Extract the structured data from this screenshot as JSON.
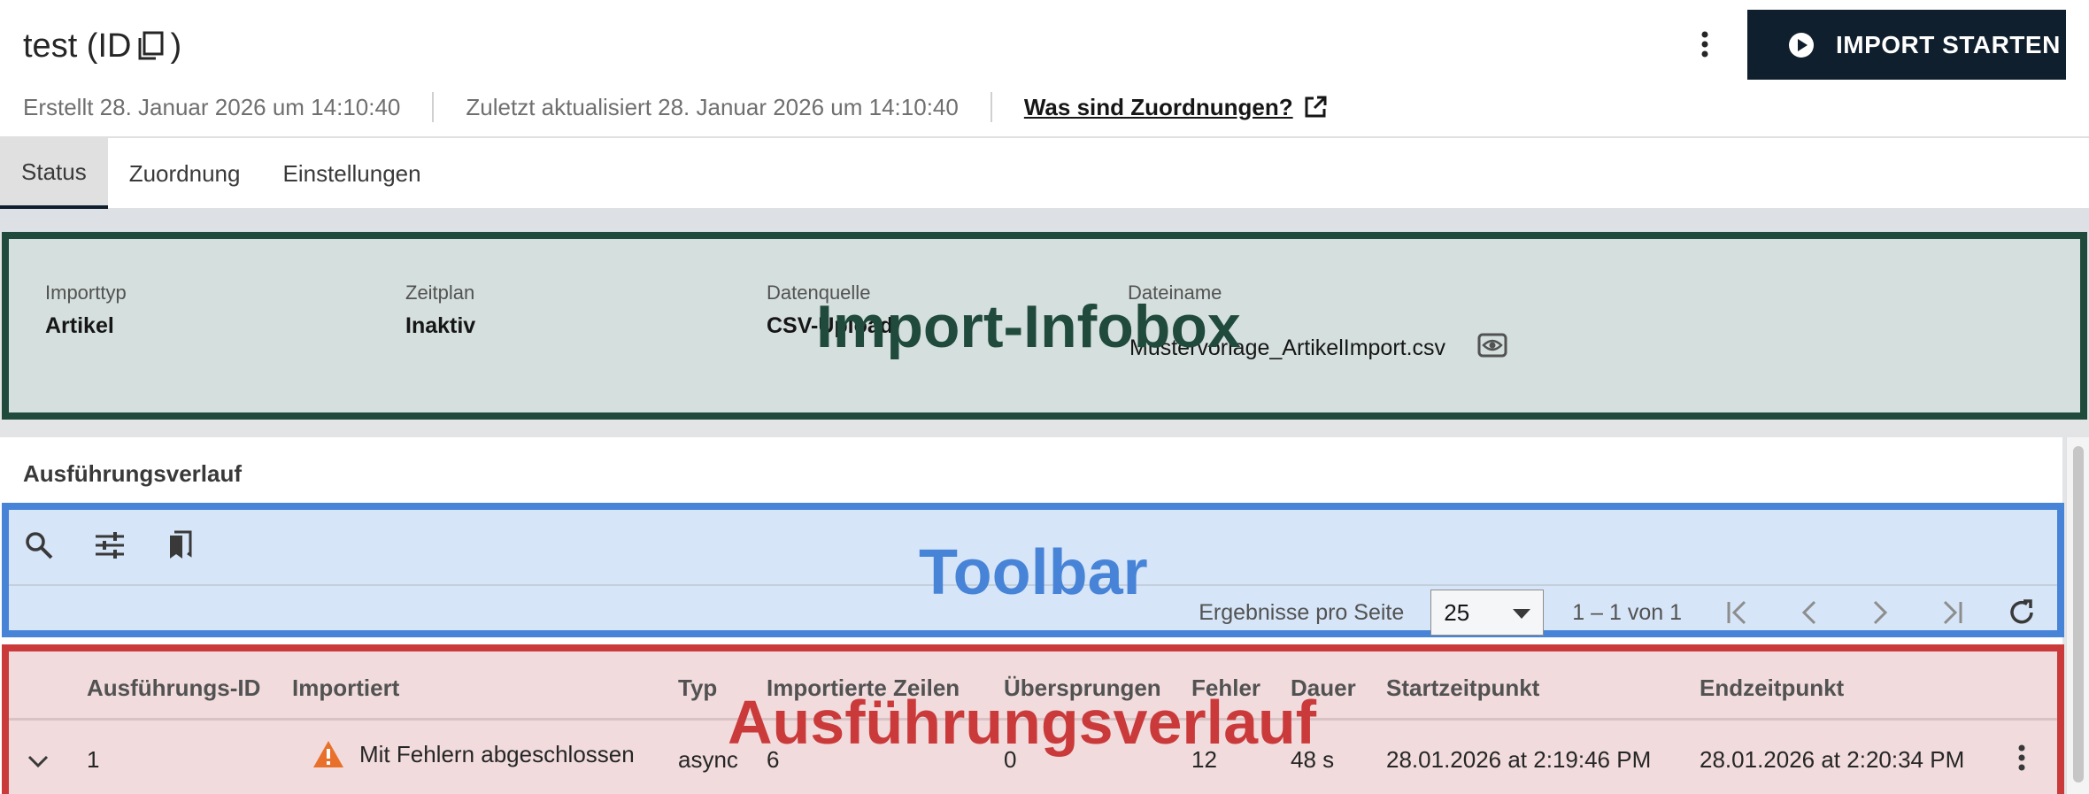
{
  "header": {
    "title": "test (ID",
    "title_close": ")",
    "created": "Erstellt 28. Januar 2026 um 14:10:40",
    "updated": "Zuletzt aktualisiert 28. Januar 2026 um 14:10:40",
    "help_link": "Was sind Zuordnungen?",
    "import_button": "IMPORT STARTEN"
  },
  "tabs": [
    {
      "label": "Status",
      "active": true
    },
    {
      "label": "Zuordnung",
      "active": false
    },
    {
      "label": "Einstellungen",
      "active": false
    }
  ],
  "infobox": {
    "overlay_label": "Import-Infobox",
    "fields": [
      {
        "label": "Importtyp",
        "value": "Artikel"
      },
      {
        "label": "Zeitplan",
        "value": "Inaktiv"
      },
      {
        "label": "Datenquelle",
        "value": "CSV-Upload"
      },
      {
        "label": "Dateiname",
        "value": "Mustervorlage_ArtikelImport.csv"
      }
    ]
  },
  "section": {
    "title": "Ausführungsverlauf"
  },
  "toolbar": {
    "overlay_label": "Toolbar",
    "icons": [
      "search-icon",
      "filter-sliders-icon",
      "bookmarks-icon"
    ],
    "page_size_label": "Ergebnisse pro Seite",
    "page_size_value": "25",
    "range_text": "1 – 1 von 1"
  },
  "table": {
    "overlay_label": "Ausführungsverlauf",
    "columns": [
      "Ausführungs-ID",
      "Importiert",
      "Typ",
      "Importierte Zeilen",
      "Übersprungen",
      "Fehler",
      "Dauer",
      "Startzeitpunkt",
      "Endzeitpunkt"
    ],
    "rows": [
      {
        "id": "1",
        "status": "Mit Fehlern abgeschlossen",
        "type": "async",
        "imported_rows": "6",
        "skipped": "0",
        "errors": "12",
        "duration": "48 s",
        "start": "28.01.2026 at 2:19:46 PM",
        "end": "28.01.2026 at 2:20:34 PM"
      }
    ]
  },
  "colors": {
    "infobox_border": "#1f4a3c",
    "toolbar_border": "#4784d8",
    "toolbar_label": "#4784d8",
    "table_border": "#cb3a3a",
    "table_label": "#cb3a3a",
    "warning": "#e8702a",
    "primary_button": "#101f2d"
  }
}
